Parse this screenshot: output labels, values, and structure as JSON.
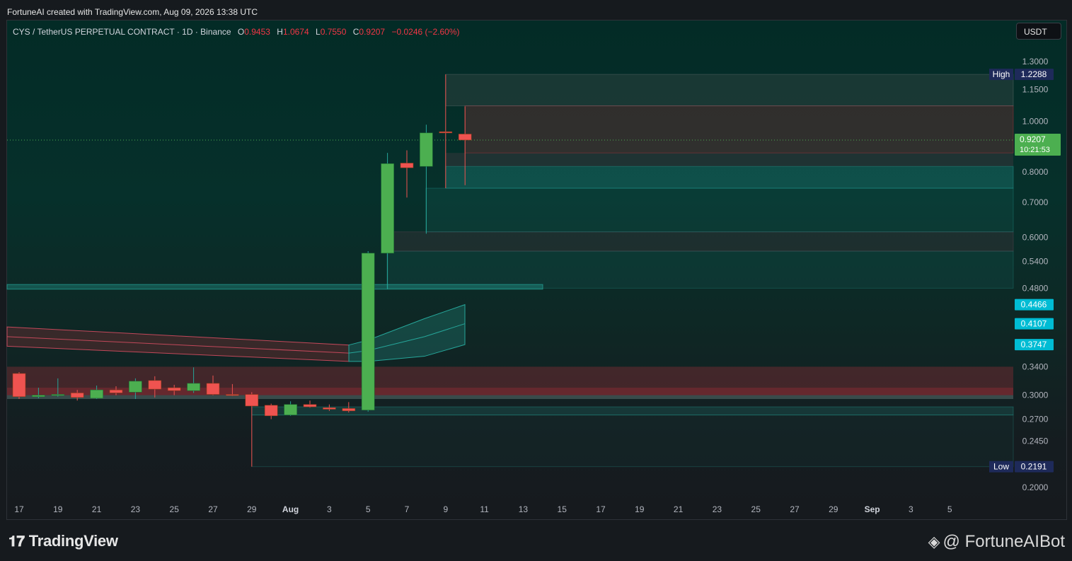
{
  "header": {
    "created_text": "FortuneAI created with TradingView.com, Aug 09, 2026 13:38 UTC"
  },
  "legend": {
    "symbol": "CYS / TetherUS PERPETUAL CONTRACT · 1D · Binance",
    "o_label": "O",
    "o_value": "0.9453",
    "h_label": "H",
    "h_value": "1.0674",
    "l_label": "L",
    "l_value": "0.7550",
    "c_label": "C",
    "c_value": "0.9207",
    "change": "−0.0246 (−2.60%)"
  },
  "currency_button": "USDT",
  "footer": {
    "brand": "TradingView",
    "handle": "@ FortuneAIBot"
  },
  "colors": {
    "up": "#4caf50",
    "down": "#ef5350",
    "accent": "#26a69a",
    "badge_cyan": "#00bcd4",
    "badge_navy": "#1e2a5a"
  },
  "chart_data": {
    "type": "candlestick",
    "timeframe": "1D",
    "y_axis_ticks": [
      "1.3000",
      "1.1500",
      "1.0000",
      "0.8000",
      "0.7000",
      "0.6000",
      "0.5400",
      "0.4800",
      "0.3400",
      "0.3000",
      "0.2700",
      "0.2450",
      "0.2000"
    ],
    "x_axis_ticks": [
      "17",
      "19",
      "21",
      "23",
      "25",
      "27",
      "29",
      "Aug",
      "3",
      "5",
      "7",
      "9",
      "11",
      "13",
      "15",
      "17",
      "19",
      "21",
      "23",
      "25",
      "27",
      "29",
      "Sep",
      "3",
      "5"
    ],
    "last_price": {
      "value": "0.9207",
      "countdown": "10:21:53"
    },
    "high_marker": {
      "label": "High",
      "value": "1.2288"
    },
    "low_marker": {
      "label": "Low",
      "value": "0.2191"
    },
    "indicator_levels": [
      "0.4466",
      "0.4107",
      "0.3747"
    ],
    "candles": [
      {
        "d": "Jul 17",
        "o": 0.33,
        "h": 0.332,
        "l": 0.295,
        "c": 0.298
      },
      {
        "d": "Jul 18",
        "o": 0.298,
        "h": 0.31,
        "l": 0.296,
        "c": 0.3
      },
      {
        "d": "Jul 19",
        "o": 0.3,
        "h": 0.323,
        "l": 0.298,
        "c": 0.301
      },
      {
        "d": "Jul 20",
        "o": 0.303,
        "h": 0.307,
        "l": 0.293,
        "c": 0.297
      },
      {
        "d": "Jul 21",
        "o": 0.296,
        "h": 0.313,
        "l": 0.295,
        "c": 0.307
      },
      {
        "d": "Jul 22",
        "o": 0.307,
        "h": 0.312,
        "l": 0.3,
        "c": 0.303
      },
      {
        "d": "Jul 23",
        "o": 0.304,
        "h": 0.323,
        "l": 0.295,
        "c": 0.319
      },
      {
        "d": "Jul 24",
        "o": 0.32,
        "h": 0.326,
        "l": 0.297,
        "c": 0.308
      },
      {
        "d": "Jul 25",
        "o": 0.31,
        "h": 0.314,
        "l": 0.3,
        "c": 0.306
      },
      {
        "d": "Jul 26",
        "o": 0.306,
        "h": 0.339,
        "l": 0.303,
        "c": 0.316
      },
      {
        "d": "Jul 27",
        "o": 0.316,
        "h": 0.327,
        "l": 0.3,
        "c": 0.301
      },
      {
        "d": "Jul 28",
        "o": 0.301,
        "h": 0.315,
        "l": 0.299,
        "c": 0.3
      },
      {
        "d": "Jul 29",
        "o": 0.301,
        "h": 0.304,
        "l": 0.2191,
        "c": 0.286
      },
      {
        "d": "Jul 30",
        "o": 0.287,
        "h": 0.289,
        "l": 0.27,
        "c": 0.274
      },
      {
        "d": "Jul 31",
        "o": 0.275,
        "h": 0.292,
        "l": 0.274,
        "c": 0.288
      },
      {
        "d": "Aug 1",
        "o": 0.288,
        "h": 0.293,
        "l": 0.284,
        "c": 0.285
      },
      {
        "d": "Aug 2",
        "o": 0.284,
        "h": 0.288,
        "l": 0.28,
        "c": 0.282
      },
      {
        "d": "Aug 3",
        "o": 0.283,
        "h": 0.291,
        "l": 0.278,
        "c": 0.28
      },
      {
        "d": "Aug 4",
        "o": 0.281,
        "h": 0.565,
        "l": 0.279,
        "c": 0.56
      },
      {
        "d": "Aug 5",
        "o": 0.56,
        "h": 0.87,
        "l": 0.478,
        "c": 0.83
      },
      {
        "d": "Aug 6",
        "o": 0.832,
        "h": 0.88,
        "l": 0.715,
        "c": 0.815
      },
      {
        "d": "Aug 7",
        "o": 0.82,
        "h": 0.985,
        "l": 0.61,
        "c": 0.95
      },
      {
        "d": "Aug 8",
        "o": 0.955,
        "h": 1.2288,
        "l": 0.745,
        "c": 0.95
      },
      {
        "d": "Aug 9",
        "o": 0.9453,
        "h": 1.0674,
        "l": 0.755,
        "c": 0.9207
      }
    ]
  }
}
